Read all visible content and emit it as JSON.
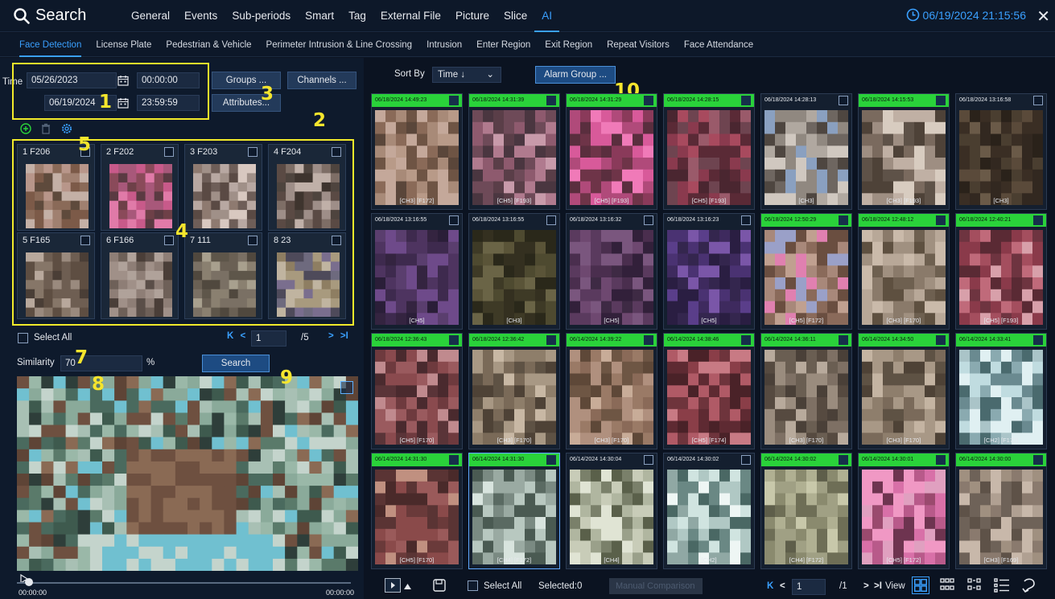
{
  "app": {
    "title": "Search",
    "datetime": "06/19/2024 21:15:56",
    "close_label": "✕"
  },
  "main_tabs": [
    "General",
    "Events",
    "Sub-periods",
    "Smart",
    "Tag",
    "External File",
    "Picture",
    "Slice",
    "AI"
  ],
  "active_main_tab": "AI",
  "sub_tabs": [
    "Face Detection",
    "License Plate",
    "Pedestrian & Vehicle",
    "Perimeter Intrusion & Line Crossing",
    "Intrusion",
    "Enter Region",
    "Exit Region",
    "Repeat Visitors",
    "Face Attendance"
  ],
  "active_sub_tab": "Face Detection",
  "filter": {
    "time_label": "Time",
    "start_date": "05/26/2023",
    "start_time": "00:00:00",
    "end_date": "06/19/2024",
    "end_time": "23:59:59",
    "groups_label": "Groups ...",
    "channels_label": "Channels ...",
    "attributes_label": "Attributes..."
  },
  "targets": [
    {
      "label": "1 F206",
      "colors": [
        "#8a6a58",
        "#b8968a",
        "#5e4a3c",
        "#c4b0a6",
        "#7c5a48",
        "#a08070"
      ]
    },
    {
      "label": "2 F202",
      "colors": [
        "#c85a8a",
        "#8a4a5a",
        "#e07aa8",
        "#5a3a42",
        "#a8587a",
        "#6e4048"
      ]
    },
    {
      "label": "3 F203",
      "colors": [
        "#b8a8a2",
        "#6e5e58",
        "#d8c8c0",
        "#8e7a70",
        "#a09088",
        "#5a4a44"
      ]
    },
    {
      "label": "4 F204",
      "colors": [
        "#5a4a44",
        "#9e8e88",
        "#3e342e",
        "#c0b0a8",
        "#7e6e66",
        "#4e443e"
      ]
    },
    {
      "label": "5 F165",
      "colors": [
        "#6e5e52",
        "#9a8a7e",
        "#4a3e36",
        "#b8a89c",
        "#867668",
        "#5e4e42"
      ]
    },
    {
      "label": "6 F166",
      "colors": [
        "#8e7e76",
        "#5a4e48",
        "#b0a29a",
        "#6e6058",
        "#a09088",
        "#4a3e38"
      ]
    },
    {
      "label": "7 111",
      "colors": [
        "#8a8070",
        "#6a6054",
        "#a8a08e",
        "#50483e",
        "#7a7064",
        "#5e564a"
      ]
    },
    {
      "label": "8 23",
      "colors": [
        "#7a6e8e",
        "#a89a7e",
        "#4e4a5a",
        "#c0b4a0",
        "#6e6a7e",
        "#8e7e62"
      ]
    }
  ],
  "select_all_label": "Select All",
  "left_pager": {
    "page": "1",
    "total": "/5"
  },
  "similarity": {
    "label": "Similarity",
    "value": "70",
    "unit": "%"
  },
  "search_label": "Search",
  "playback": {
    "start": "00:00:00",
    "end": "00:00:00"
  },
  "sort": {
    "label": "Sort By",
    "value": "Time ↓",
    "alarm_group": "Alarm Group ..."
  },
  "results": [
    {
      "ts": "06/18/2024 14:49:23",
      "cap": "[CH3] [F172]",
      "green": true,
      "colors": [
        "#a88a78",
        "#6e5444",
        "#c4a89a",
        "#8a6a58",
        "#5a463a",
        "#b89a88"
      ]
    },
    {
      "ts": "06/18/2024 14:31:39",
      "cap": "[CH5] [F193]",
      "green": true,
      "colors": [
        "#8e5a6e",
        "#5a3e48",
        "#b07a8e",
        "#6e4a58",
        "#c89aaa",
        "#4a3640"
      ]
    },
    {
      "ts": "06/18/2024 14:31:29",
      "cap": "[CH5] [F193]",
      "green": true,
      "colors": [
        "#d85a9a",
        "#8a3a5a",
        "#f07ab8",
        "#5a2e3e",
        "#b04a7a",
        "#6e3448"
      ]
    },
    {
      "ts": "06/18/2024 14:28:15",
      "cap": "[CH5] [F193]",
      "green": true,
      "colors": [
        "#8a3a4e",
        "#5a2a36",
        "#a84a5e",
        "#6e4450",
        "#4a2630",
        "#9a5a6a"
      ]
    },
    {
      "ts": "06/18/2024 14:28:13",
      "cap": "[CH3]",
      "green": false,
      "colors": [
        "#b0a8a0",
        "#6e6660",
        "#d0c8c0",
        "#4e4640",
        "#908880",
        "#8aa0c0"
      ]
    },
    {
      "ts": "06/18/2024 14:15:53",
      "cap": "[CH3] [F193]",
      "green": true,
      "colors": [
        "#7a6a5e",
        "#c0b0a4",
        "#4e4238",
        "#9e8e82",
        "#5e5248",
        "#d8ccc0"
      ]
    },
    {
      "ts": "06/18/2024 13:16:58",
      "cap": "[CH3]",
      "green": false,
      "colors": [
        "#3a2e24",
        "#5a4a3a",
        "#2a221a",
        "#4a3e30",
        "#6a5a48",
        "#322820"
      ]
    },
    {
      "ts": "06/18/2024 13:16:55",
      "cap": "[CH5]",
      "green": false,
      "colors": [
        "#3e2a4e",
        "#5a3e6e",
        "#2a1e38",
        "#4e3460",
        "#6e4a8a",
        "#342440"
      ]
    },
    {
      "ts": "06/18/2024 13:16:55",
      "cap": "[CH3]",
      "green": false,
      "colors": [
        "#3e3a26",
        "#5a5438",
        "#2a281a",
        "#4e4a30",
        "#6a6446",
        "#343020"
      ]
    },
    {
      "ts": "06/18/2024 13:16:32",
      "cap": "[CH5]",
      "green": false,
      "colors": [
        "#4a2e4e",
        "#6e4870",
        "#32203a",
        "#5a3a5e",
        "#7a567e",
        "#3e2a44"
      ]
    },
    {
      "ts": "06/18/2024 13:16:23",
      "cap": "[CH5]",
      "green": false,
      "colors": [
        "#3e2a5e",
        "#5a3e8a",
        "#2a1e42",
        "#4a3272",
        "#7a56a8",
        "#34264e"
      ]
    },
    {
      "ts": "06/18/2024 12:50:29",
      "cap": "[CH5] [F172]",
      "green": true,
      "colors": [
        "#c0a090",
        "#8a6a5a",
        "#e080b0",
        "#6a4e40",
        "#a8887a",
        "#9aa0c8"
      ]
    },
    {
      "ts": "06/18/2024 12:48:12",
      "cap": "[CH3] [F170]",
      "green": true,
      "colors": [
        "#8a7a6a",
        "#b8a898",
        "#5e5040",
        "#a09080",
        "#6e6050",
        "#cabaaa"
      ]
    },
    {
      "ts": "06/18/2024 12:40:21",
      "cap": "[CH5] [F193]",
      "green": true,
      "colors": [
        "#8a3a4a",
        "#c06a7a",
        "#5a2a34",
        "#a44e5e",
        "#d8a0aa",
        "#6e3440"
      ]
    },
    {
      "ts": "06/18/2024 12:36:43",
      "cap": "[CH5] [F170]",
      "green": true,
      "colors": [
        "#6e3a3e",
        "#9a5a5e",
        "#4a2a2e",
        "#c08a8e",
        "#8a4a4e",
        "#5a3438"
      ]
    },
    {
      "ts": "06/18/2024 12:36:42",
      "cap": "[CH3] [F170]",
      "green": true,
      "colors": [
        "#7a6a58",
        "#a89884",
        "#4e4236",
        "#c8b8a4",
        "#8e7e6a",
        "#5e5244"
      ]
    },
    {
      "ts": "06/14/2024 14:39:22",
      "cap": "[CH3] [F170]",
      "green": true,
      "colors": [
        "#8a6a58",
        "#b0907e",
        "#5e4838",
        "#c8ac98",
        "#9a7a66",
        "#6e5644"
      ]
    },
    {
      "ts": "06/14/2024 14:38:46",
      "cap": "[CH5] [F174]",
      "green": true,
      "colors": [
        "#8a3e48",
        "#5e2a32",
        "#b05a66",
        "#6e343c",
        "#c87a84",
        "#4a2228"
      ]
    },
    {
      "ts": "06/14/2024 14:36:11",
      "cap": "[CH3] [F170]",
      "green": true,
      "colors": [
        "#6a5e52",
        "#9a8c7e",
        "#4a4038",
        "#b8aa9c",
        "#7e7064",
        "#564a40"
      ]
    },
    {
      "ts": "06/14/2024 14:34:50",
      "cap": "[CH3] [F170]",
      "green": true,
      "colors": [
        "#7a6a5a",
        "#a89886",
        "#4e4236",
        "#c4b4a2",
        "#8e7e6c",
        "#5e5244"
      ]
    },
    {
      "ts": "06/14/2024 14:33:41",
      "cap": "[CH2] [F172]",
      "green": true,
      "colors": [
        "#c0dce0",
        "#8aaab0",
        "#e0f0f2",
        "#6a8a90",
        "#aac4c8",
        "#4a6a6e"
      ]
    },
    {
      "ts": "06/14/2024 14:31:30",
      "cap": "[CH5] [F170]",
      "green": true,
      "colors": [
        "#6a3a3a",
        "#9a5a5a",
        "#4a2a2a",
        "#c09080",
        "#8a4a4a",
        "#5a3434"
      ]
    },
    {
      "ts": "06/14/2024 14:31:30",
      "cap": "[CH4] [F172]",
      "green": true,
      "colors": [
        "#b8c8c0",
        "#7a8a82",
        "#d8e4de",
        "#5a6a62",
        "#9aaaa2",
        "#4a5a52"
      ]
    },
    {
      "ts": "06/14/2024 14:30:04",
      "cap": "[CH4]",
      "green": false,
      "colors": [
        "#c8ccb8",
        "#9aa08a",
        "#e0e4d4",
        "#7a806a",
        "#b0b6a0",
        "#5a604a"
      ]
    },
    {
      "ts": "06/14/2024 14:30:02",
      "cap": "[CH2]",
      "green": false,
      "colors": [
        "#d0e4e0",
        "#90a8a4",
        "#eef6f4",
        "#6a8884",
        "#b0c8c4",
        "#4a6864"
      ]
    },
    {
      "ts": "06/14/2024 14:30:02",
      "cap": "[CH4] [F172]",
      "green": true,
      "colors": [
        "#8a8a6e",
        "#b0b092",
        "#5e5e4a",
        "#a0a084",
        "#6e6e56",
        "#c8c8aa"
      ]
    },
    {
      "ts": "06/14/2024 14:30:01",
      "cap": "[CH5] [F172]",
      "green": true,
      "colors": [
        "#d870a8",
        "#9a4a6e",
        "#f098c4",
        "#6e3450",
        "#b85a8a",
        "#e0a0c0"
      ]
    },
    {
      "ts": "06/14/2024 14:30:00",
      "cap": "[CH3] [F169]",
      "green": true,
      "colors": [
        "#8a7a6e",
        "#b0a092",
        "#5e5248",
        "#a09080",
        "#6e6258",
        "#c8b8aa"
      ]
    }
  ],
  "bottom": {
    "select_all_label": "Select All",
    "selected_label": "Selected:0",
    "manual_comparison": "Manual Comparison",
    "page": "1",
    "total": "/1",
    "view_label": "View"
  },
  "annotations": [
    "1",
    "2",
    "3",
    "4",
    "5",
    "7",
    "8",
    "9",
    "10"
  ],
  "colors": {
    "accent": "#3aa0ff",
    "highlight_box": "#f2ea2a",
    "alarm_green": "#2ad23a"
  }
}
